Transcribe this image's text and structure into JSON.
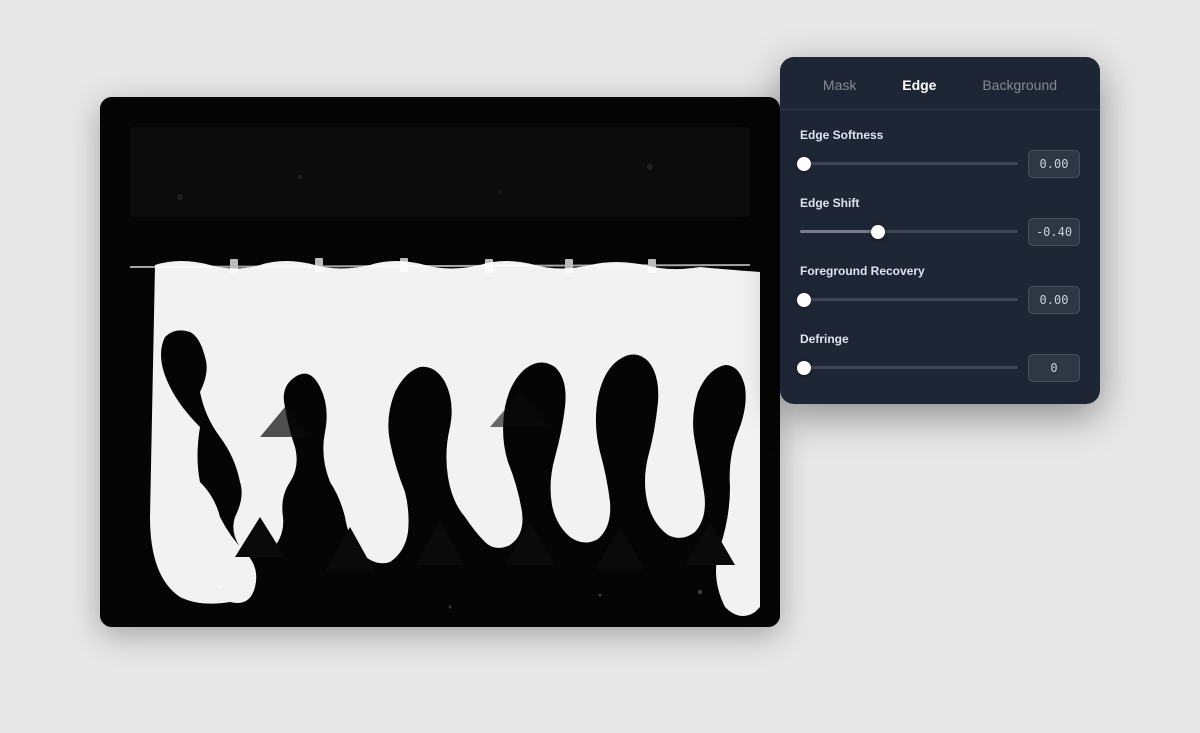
{
  "tabs": [
    {
      "id": "mask",
      "label": "Mask",
      "active": false
    },
    {
      "id": "edge",
      "label": "Edge",
      "active": true
    },
    {
      "id": "background",
      "label": "Background",
      "active": false
    }
  ],
  "controls": [
    {
      "id": "edge-softness",
      "label": "Edge Softness",
      "value": "0.00",
      "thumbPercent": 2,
      "fillPercent": 2
    },
    {
      "id": "edge-shift",
      "label": "Edge Shift",
      "value": "-0.40",
      "thumbPercent": 36,
      "fillPercent": 36
    },
    {
      "id": "foreground-recovery",
      "label": "Foreground Recovery",
      "value": "0.00",
      "thumbPercent": 2,
      "fillPercent": 2
    },
    {
      "id": "defringe",
      "label": "Defringe",
      "value": "0",
      "thumbPercent": 2,
      "fillPercent": 2
    }
  ],
  "image": {
    "alt": "Mask preview - clothes on a line with black and white mask"
  }
}
